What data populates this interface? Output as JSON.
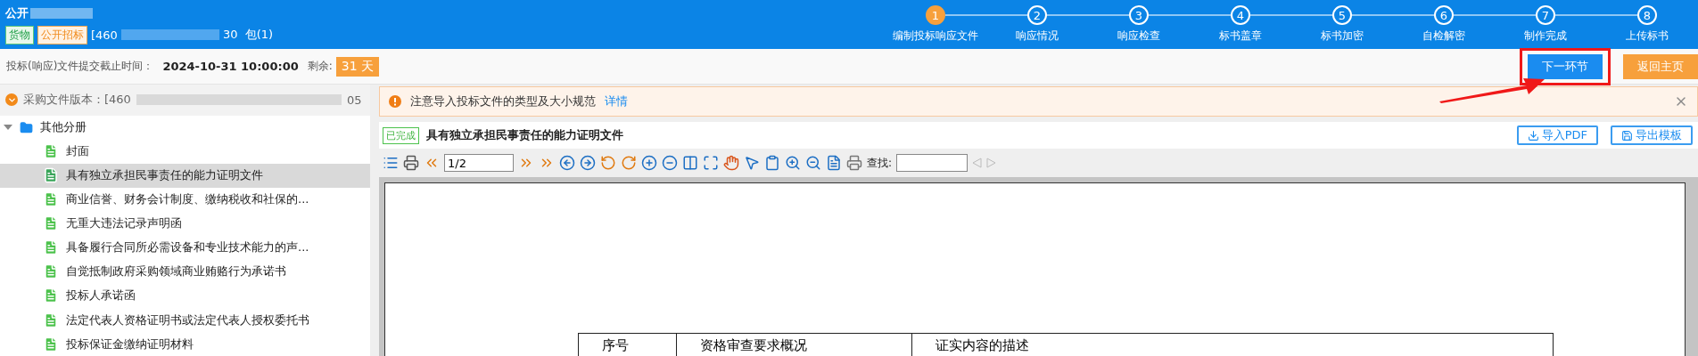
{
  "header": {
    "title": "公开",
    "tags": [
      {
        "label": "货物",
        "kind": "goods"
      },
      {
        "label": "公开招标",
        "kind": "method"
      }
    ],
    "project_prefix": "[460",
    "project_suffix": "30  包(1)"
  },
  "steps": [
    {
      "number": "1",
      "label": "编制投标响应文件",
      "selected": true
    },
    {
      "number": "2",
      "label": "响应情况",
      "selected": false
    },
    {
      "number": "3",
      "label": "响应检查",
      "selected": false
    },
    {
      "number": "4",
      "label": "标书盖章",
      "selected": false
    },
    {
      "number": "5",
      "label": "标书加密",
      "selected": false
    },
    {
      "number": "6",
      "label": "自检解密",
      "selected": false
    },
    {
      "number": "7",
      "label": "制作完成",
      "selected": false
    },
    {
      "number": "8",
      "label": "上传标书",
      "selected": false
    }
  ],
  "deadline": {
    "label": "投标(响应)文件提交截止时间：",
    "value": "2024-10-31 10:00:00",
    "remaining_label": "剩余:",
    "remaining": "31 天"
  },
  "actions": [
    {
      "label": "下一环节",
      "kind": "primary",
      "highlighted": true
    },
    {
      "label": "返回主页",
      "kind": "secondary",
      "highlighted": false
    }
  ],
  "version": {
    "label": "采购文件版本：[460",
    "suffix": "05"
  },
  "notice": {
    "text": "注意导入投标文件的类型及大小规范",
    "link": "详情"
  },
  "tree": [
    {
      "label": "其他分册",
      "expanded": true,
      "children": [
        {
          "label": "封面",
          "selected": false
        },
        {
          "label": "具有独立承担民事责任的能力证明文件",
          "selected": true
        },
        {
          "label": "商业信誉、财务会计制度、缴纳税收和社保的...",
          "selected": false
        },
        {
          "label": "无重大违法记录声明函",
          "selected": false
        },
        {
          "label": "具备履行合同所必需设备和专业技术能力的声...",
          "selected": false
        },
        {
          "label": "自觉抵制政府采购领域商业贿赂行为承诺书",
          "selected": false
        },
        {
          "label": "投标人承诺函",
          "selected": false
        },
        {
          "label": "法定代表人资格证明书或法定代表人授权委托书",
          "selected": false
        },
        {
          "label": "投标保证金缴纳证明材料",
          "selected": false
        }
      ]
    }
  ],
  "document": {
    "status": "已完成",
    "title": "具有独立承担民事责任的能力证明文件",
    "buttons": [
      {
        "label": "导入PDF",
        "kind": "import"
      },
      {
        "label": "导出模板",
        "kind": "export"
      }
    ]
  },
  "viewer": {
    "page": "1/2",
    "find_label": "查找:",
    "table_headers": [
      "序号",
      "资格审查要求概况",
      "证实内容的描述"
    ]
  }
}
